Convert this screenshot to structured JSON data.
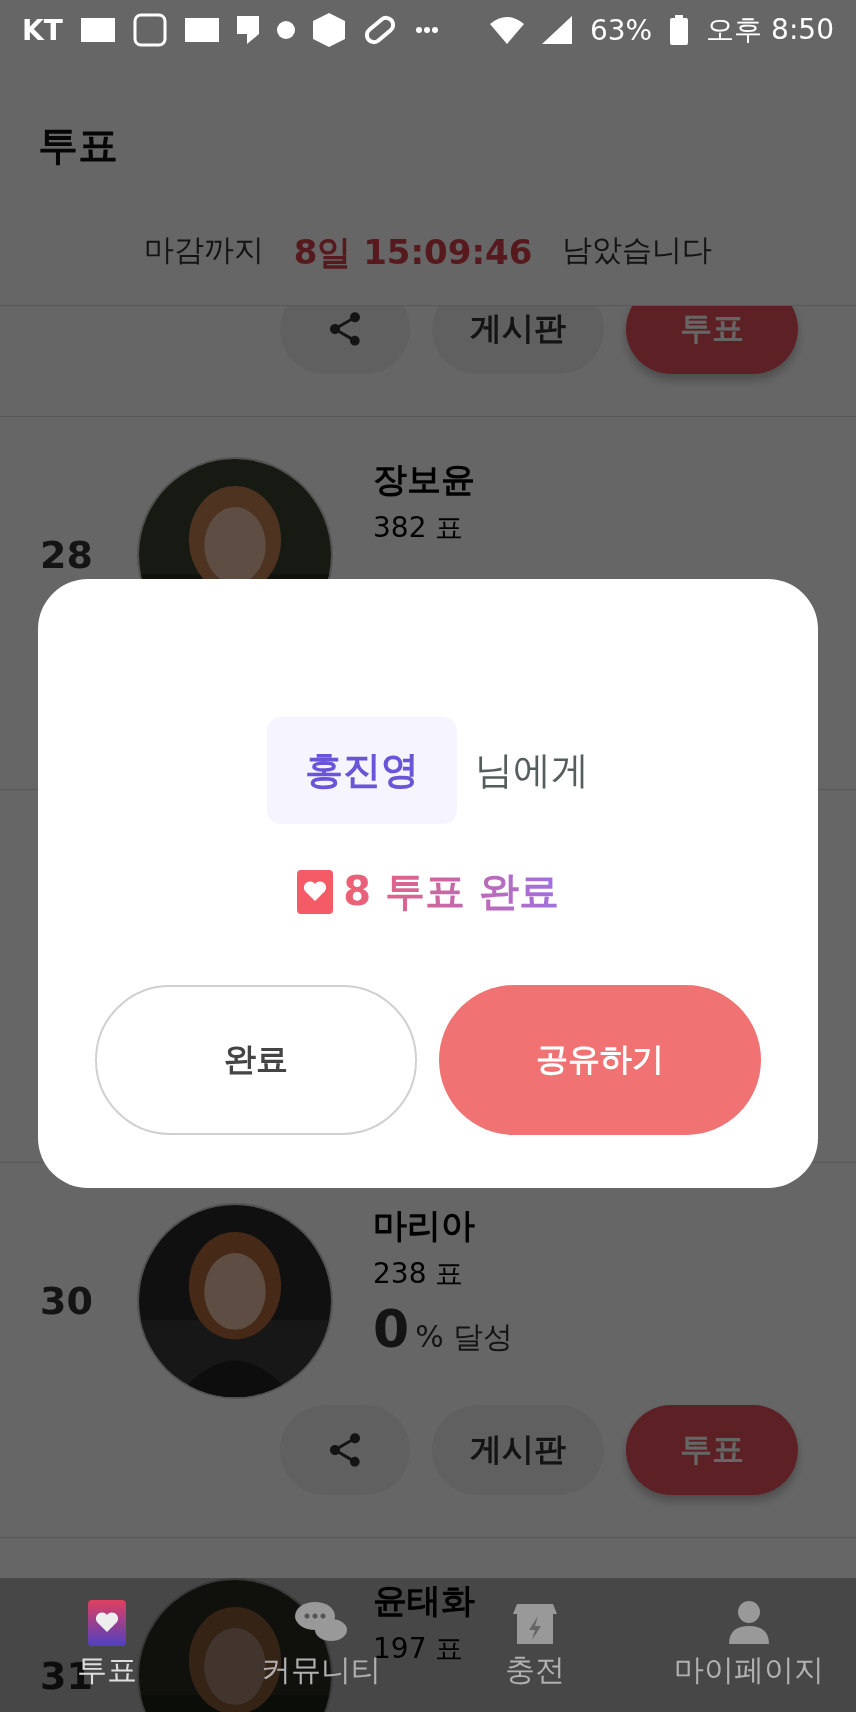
{
  "status_bar": {
    "carrier": "KT",
    "battery": "63%",
    "time": "오후 8:50"
  },
  "header": {
    "title": "투표"
  },
  "countdown": {
    "prefix": "마감까지",
    "remaining": "8일 15:09:46",
    "suffix": "남았습니다"
  },
  "candidates": [
    {
      "kind": "partial",
      "buttons": [
        "게시판",
        "투표"
      ]
    },
    {
      "kind": "top",
      "rank": "28",
      "name": "장보윤",
      "votes": "382 표"
    },
    {
      "kind": "hidden"
    },
    {
      "kind": "full",
      "rank": "30",
      "name": "마리아",
      "votes": "238 표",
      "percent": "0",
      "percent_label": "% 달성",
      "buttons": [
        "게시판",
        "투표"
      ]
    },
    {
      "kind": "top",
      "rank": "31",
      "name": "윤태화",
      "votes": "197 표"
    }
  ],
  "dialog": {
    "candidate": "홍진영",
    "candidate_suffix": "님에게",
    "result": "8 투표 완료",
    "buttons": [
      "완료",
      "공유하기"
    ]
  },
  "bottom_nav": [
    {
      "label": "투표",
      "selected": true
    },
    {
      "label": "커뮤니티",
      "selected": false
    },
    {
      "label": "충전",
      "selected": false
    },
    {
      "label": "마이페이지",
      "selected": false
    }
  ]
}
